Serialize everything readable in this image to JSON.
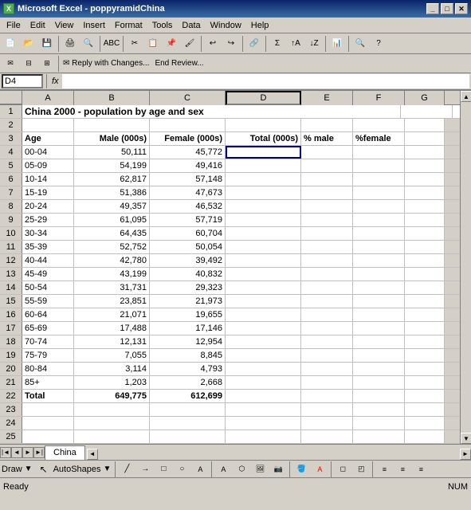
{
  "titlebar": {
    "title": "Microsoft Excel - poppyramidChina",
    "icon": "X"
  },
  "menu": {
    "items": [
      "File",
      "Edit",
      "View",
      "Insert",
      "Format",
      "Tools",
      "Data",
      "Window",
      "Help"
    ]
  },
  "formula_bar": {
    "cell_ref": "D4",
    "fx": "fx",
    "value": ""
  },
  "spreadsheet": {
    "col_headers": [
      "A",
      "B",
      "C",
      "D",
      "E",
      "F",
      "G"
    ],
    "rows": [
      {
        "num": "1",
        "cells": [
          "China 2000 - population by age and sex",
          "",
          "",
          "",
          "",
          "",
          ""
        ]
      },
      {
        "num": "2",
        "cells": [
          "",
          "",
          "",
          "",
          "",
          "",
          ""
        ]
      },
      {
        "num": "3",
        "cells": [
          "Age",
          "Male (000s)",
          "Female (000s)",
          "Total (000s)",
          "% male",
          "%female",
          ""
        ]
      },
      {
        "num": "4",
        "cells": [
          "00-04",
          "50,111",
          "45,772",
          "",
          "",
          "",
          ""
        ]
      },
      {
        "num": "5",
        "cells": [
          "05-09",
          "54,199",
          "49,416",
          "",
          "",
          "",
          ""
        ]
      },
      {
        "num": "6",
        "cells": [
          "10-14",
          "62,817",
          "57,148",
          "",
          "",
          "",
          ""
        ]
      },
      {
        "num": "7",
        "cells": [
          "15-19",
          "51,386",
          "47,673",
          "",
          "",
          "",
          ""
        ]
      },
      {
        "num": "8",
        "cells": [
          "20-24",
          "49,357",
          "46,532",
          "",
          "",
          "",
          ""
        ]
      },
      {
        "num": "9",
        "cells": [
          "25-29",
          "61,095",
          "57,719",
          "",
          "",
          "",
          ""
        ]
      },
      {
        "num": "10",
        "cells": [
          "30-34",
          "64,435",
          "60,704",
          "",
          "",
          "",
          ""
        ]
      },
      {
        "num": "11",
        "cells": [
          "35-39",
          "52,752",
          "50,054",
          "",
          "",
          "",
          ""
        ]
      },
      {
        "num": "12",
        "cells": [
          "40-44",
          "42,780",
          "39,492",
          "",
          "",
          "",
          ""
        ]
      },
      {
        "num": "13",
        "cells": [
          "45-49",
          "43,199",
          "40,832",
          "",
          "",
          "",
          ""
        ]
      },
      {
        "num": "14",
        "cells": [
          "50-54",
          "31,731",
          "29,323",
          "",
          "",
          "",
          ""
        ]
      },
      {
        "num": "15",
        "cells": [
          "55-59",
          "23,851",
          "21,973",
          "",
          "",
          "",
          ""
        ]
      },
      {
        "num": "16",
        "cells": [
          "60-64",
          "21,071",
          "19,655",
          "",
          "",
          "",
          ""
        ]
      },
      {
        "num": "17",
        "cells": [
          "65-69",
          "17,488",
          "17,146",
          "",
          "",
          "",
          ""
        ]
      },
      {
        "num": "18",
        "cells": [
          "70-74",
          "12,131",
          "12,954",
          "",
          "",
          "",
          ""
        ]
      },
      {
        "num": "19",
        "cells": [
          "75-79",
          "7,055",
          "8,845",
          "",
          "",
          "",
          ""
        ]
      },
      {
        "num": "20",
        "cells": [
          "80-84",
          "3,114",
          "4,793",
          "",
          "",
          "",
          ""
        ]
      },
      {
        "num": "21",
        "cells": [
          "85+",
          "1,203",
          "2,668",
          "",
          "",
          "",
          ""
        ]
      },
      {
        "num": "22",
        "cells": [
          "Total",
          "649,775",
          "612,699",
          "",
          "",
          "",
          ""
        ]
      },
      {
        "num": "23",
        "cells": [
          "",
          "",
          "",
          "",
          "",
          "",
          ""
        ]
      },
      {
        "num": "24",
        "cells": [
          "",
          "",
          "",
          "",
          "",
          "",
          ""
        ]
      },
      {
        "num": "25",
        "cells": [
          "",
          "",
          "",
          "",
          "",
          "",
          ""
        ]
      }
    ]
  },
  "sheet_tab": "China",
  "status": {
    "left": "Ready",
    "right": "NUM"
  },
  "draw_toolbar": {
    "draw_label": "Draw",
    "autoshapes_label": "AutoShapes"
  }
}
